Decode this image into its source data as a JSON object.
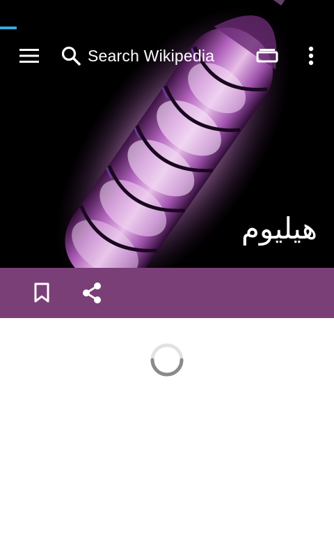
{
  "toolbar": {
    "search_placeholder": "Search Wikipedia",
    "menu_icon": "hamburger-menu-icon",
    "search_icon": "search-icon",
    "tabs_icon": "tabs-icon",
    "overflow_icon": "more-vertical-icon"
  },
  "article": {
    "title": "هيليوم",
    "lead_image": "glowing helium discharge tube"
  },
  "action_bar": {
    "bookmark_icon": "bookmark-icon",
    "share_icon": "share-icon",
    "background_color": "#7b3f77"
  },
  "status": {
    "loading": true,
    "progress": 0.05,
    "accent_color": "#33aadd"
  }
}
